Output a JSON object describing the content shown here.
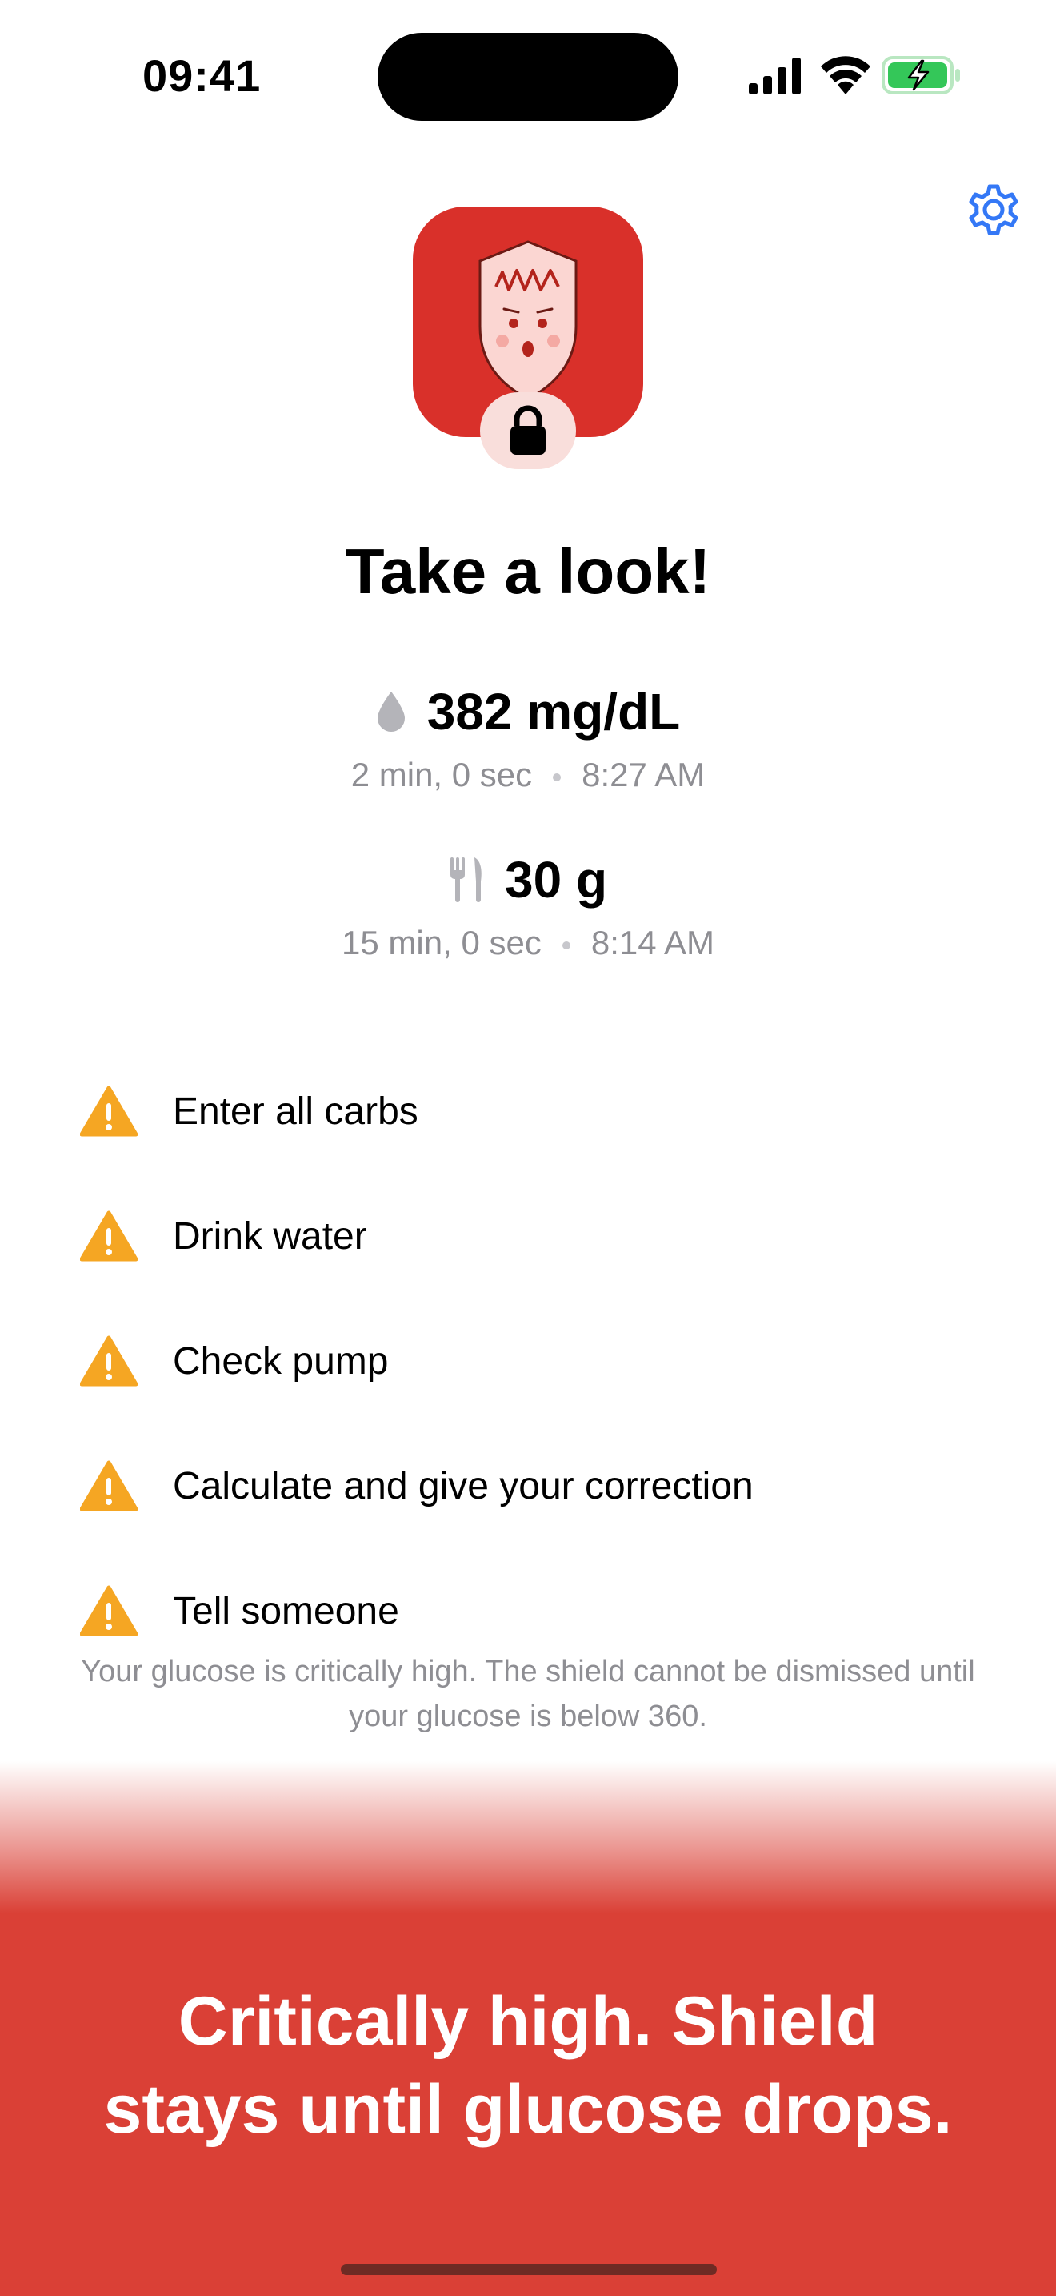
{
  "status_bar": {
    "time": "09:41",
    "icons": [
      "cellular-signal-icon",
      "wifi-icon",
      "battery-charging-icon"
    ],
    "battery_color": "#34c759"
  },
  "header": {
    "settings_icon": "gear-icon",
    "accent_color": "#3478f6"
  },
  "app_icon": {
    "background_color": "#d9302a",
    "badge_icon": "lock-icon"
  },
  "title": "Take a look!",
  "glucose": {
    "icon": "drop-icon",
    "value": "382 mg/dL",
    "elapsed": "2 min, 0 sec",
    "time": "8:27 AM"
  },
  "carbs": {
    "icon": "fork-knife-icon",
    "value": "30 g",
    "elapsed": "15 min, 0 sec",
    "time": "8:14 AM"
  },
  "checklist": {
    "icon": "warning-icon",
    "icon_color": "#f5a623",
    "items": [
      {
        "label": "Enter all carbs"
      },
      {
        "label": "Drink water"
      },
      {
        "label": "Check pump"
      },
      {
        "label": "Calculate and give your correction"
      },
      {
        "label": "Tell someone"
      }
    ]
  },
  "footnote": "Your glucose is critically high. The shield cannot be dismissed until your glucose is below 360.",
  "banner": {
    "line1": "Critically high. Shield",
    "line2": "stays until glucose drops.",
    "background_color": "#da4036"
  }
}
